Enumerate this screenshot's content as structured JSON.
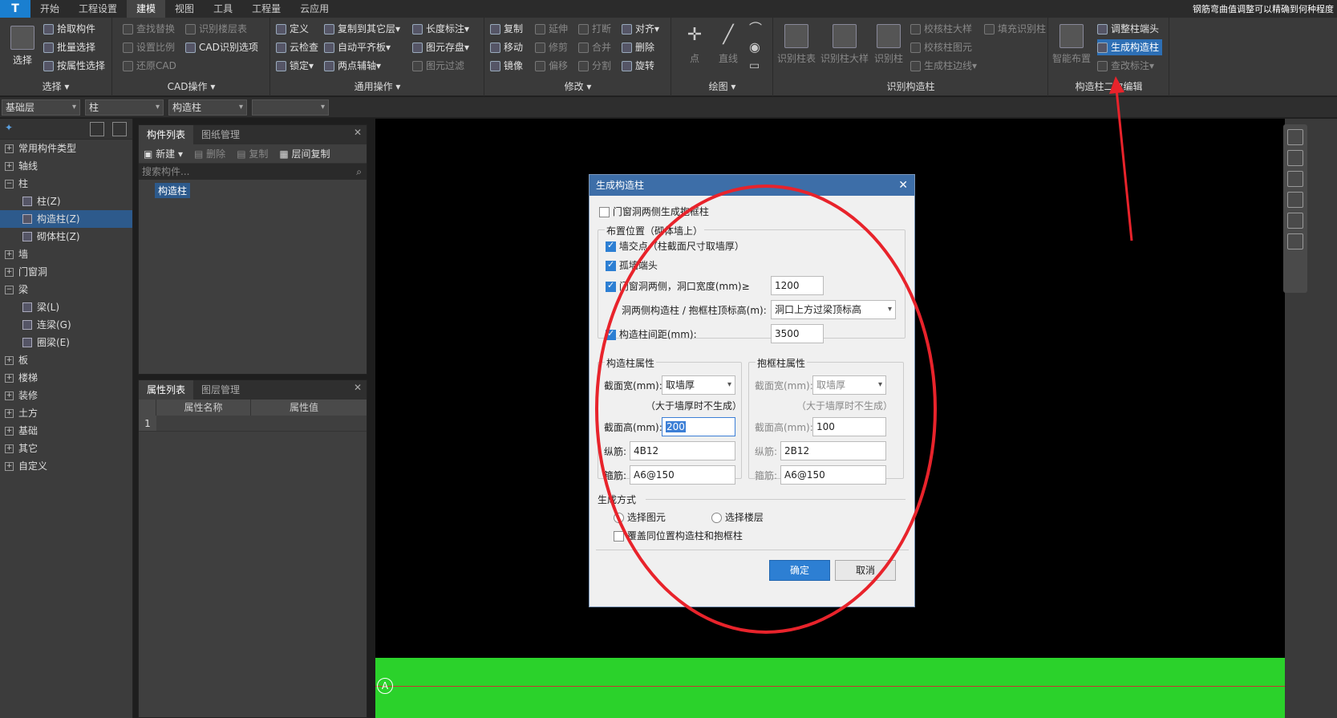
{
  "app": {
    "logo": "T",
    "top_right_text": "钢筋弯曲值调整可以精确到何种程度"
  },
  "menu": [
    "开始",
    "工程设置",
    "建模",
    "视图",
    "工具",
    "工程量",
    "云应用"
  ],
  "menu_active": "建模",
  "ribbon": {
    "select": {
      "title": "选择",
      "big": "选择",
      "items": [
        "拾取构件",
        "批量选择",
        "按属性选择"
      ]
    },
    "cad": {
      "title": "CAD操作",
      "items": [
        "查找替换",
        "识别楼层表",
        "设置比例",
        "CAD识别选项",
        "还原CAD"
      ]
    },
    "common": {
      "title": "通用操作",
      "items": [
        "定义",
        "复制到其它层",
        "长度标注",
        "云检查",
        "自动平齐板",
        "图元存盘",
        "锁定",
        "两点辅轴",
        "图元过滤"
      ]
    },
    "modify": {
      "title": "修改",
      "items": [
        "复制",
        "延伸",
        "打断",
        "对齐",
        "移动",
        "修剪",
        "合并",
        "删除",
        "镜像",
        "偏移",
        "分割",
        "旋转"
      ]
    },
    "draw": {
      "title": "绘图",
      "items": [
        "点",
        "直线"
      ]
    },
    "recognize": {
      "title": "识别构造柱",
      "items": [
        "识别柱表",
        "识别柱大样",
        "识别柱",
        "校核柱大样",
        "校核柱图元",
        "生成柱边线",
        "填充识别柱"
      ]
    },
    "second": {
      "title": "构造柱二次编辑",
      "items": [
        "智能布置",
        "调整柱端头",
        "生成构造柱",
        "查改标注"
      ]
    }
  },
  "toolbar2": {
    "floor": "基础层",
    "type": "柱",
    "sub": "构造柱",
    "extra": ""
  },
  "tree": [
    {
      "label": "常用构件类型",
      "kind": "group"
    },
    {
      "label": "轴线",
      "kind": "group"
    },
    {
      "label": "柱",
      "kind": "group-open"
    },
    {
      "label": "柱(Z)",
      "kind": "child"
    },
    {
      "label": "构造柱(Z)",
      "kind": "child-sel"
    },
    {
      "label": "砌体柱(Z)",
      "kind": "child"
    },
    {
      "label": "墙",
      "kind": "group"
    },
    {
      "label": "门窗洞",
      "kind": "group"
    },
    {
      "label": "梁",
      "kind": "group-open"
    },
    {
      "label": "梁(L)",
      "kind": "child"
    },
    {
      "label": "连梁(G)",
      "kind": "child"
    },
    {
      "label": "圈梁(E)",
      "kind": "child"
    },
    {
      "label": "板",
      "kind": "group"
    },
    {
      "label": "楼梯",
      "kind": "group"
    },
    {
      "label": "装修",
      "kind": "group"
    },
    {
      "label": "土方",
      "kind": "group"
    },
    {
      "label": "基础",
      "kind": "group"
    },
    {
      "label": "其它",
      "kind": "group"
    },
    {
      "label": "自定义",
      "kind": "group"
    }
  ],
  "complist": {
    "tab1": "构件列表",
    "tab2": "图纸管理",
    "new": "新建",
    "delete": "删除",
    "copy": "复制",
    "floor_copy": "层间复制",
    "search_ph": "搜索构件...",
    "item": "构造柱"
  },
  "props": {
    "tab1": "属性列表",
    "tab2": "图层管理",
    "col1": "属性名称",
    "col2": "属性值",
    "row1": "1"
  },
  "canvas": {
    "axis": "A"
  },
  "dialog": {
    "title": "生成构造柱",
    "door_both": "门窗洞两侧生成抱框柱",
    "pos_title": "布置位置（砌体墙上）",
    "wall_cross": "墙交点（柱截面尺寸取墙厚）",
    "isolated": "孤墙端头",
    "door_side": "门窗洞两侧，洞口宽度(mm)≥",
    "door_width": "1200",
    "top_elev_label": "洞两侧构造柱 / 抱框柱顶标高(m):",
    "top_elev": "洞口上方过梁顶标高",
    "spacing_label": "构造柱间距(mm):",
    "spacing": "3500",
    "gzz_title": "构造柱属性",
    "bkz_title": "抱框柱属性",
    "w_label": "截面宽(mm):",
    "w_val": "取墙厚",
    "note": "（大于墙厚时不生成）",
    "h_label": "截面高(mm):",
    "gzz_h": "200",
    "bkz_h": "100",
    "zj_label": "纵筋:",
    "gzz_zj": "4B12",
    "bkz_zj": "2B12",
    "gj_label": "箍筋:",
    "gzz_gj": "A6@150",
    "bkz_gj": "A6@150",
    "gen_title": "生成方式",
    "sel_elem": "选择图元",
    "sel_floor": "选择楼层",
    "overwrite": "覆盖同位置构造柱和抱框柱",
    "ok": "确定",
    "cancel": "取消"
  },
  "colors": {
    "accent": "#2d7fd3",
    "annotation": "#e8232b",
    "ground": "#2bd22b"
  }
}
